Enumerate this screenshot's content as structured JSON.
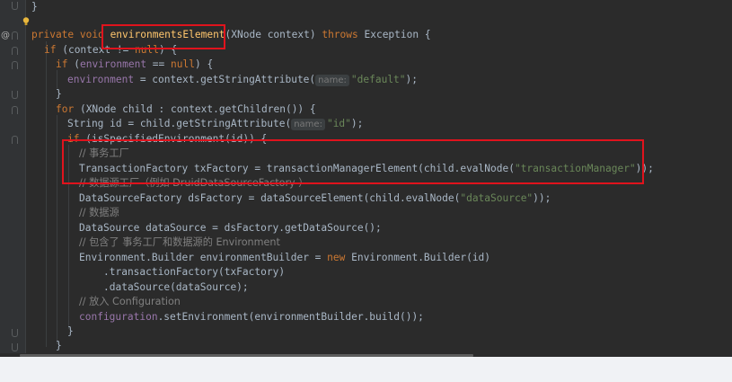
{
  "gutter": {
    "override_marker": "@"
  },
  "code": {
    "l0": "}",
    "l1_kw": "private void ",
    "l1_name": "environmentsElement",
    "l1_rest_a": "(XNode context) ",
    "l1_throws": "throws",
    "l1_rest_b": " Exception {",
    "l2_kw": "if",
    "l2_rest": " (context != ",
    "l2_null": "null",
    "l2_end": ") {",
    "l3_kw": "if",
    "l3_open": " (",
    "l3_field": "environment",
    "l3_mid": " == ",
    "l3_null": "null",
    "l3_end": ") {",
    "l4_field": "environment",
    "l4_rest": " = context.getStringAttribute(",
    "l4_hint": "name:",
    "l4_str": "\"default\"",
    "l4_end": ");",
    "l5": "}",
    "l6_kw": "for",
    "l6_rest": " (XNode child : context.getChildren()) {",
    "l7_rest": "String id = child.getStringAttribute(",
    "l7_hint": "name:",
    "l7_str": "\"id\"",
    "l7_end": ");",
    "l8_kw": "if",
    "l8_rest": " (isSpecifiedEnvironment(id)) {",
    "l9_cmt": "// 事务工厂",
    "l10_rest": "TransactionFactory txFactory = transactionManagerElement(child.evalNode(",
    "l10_str": "\"transactionManager\"",
    "l10_end": "));",
    "l11_cmt": "// 数据源工厂（例如 DruidDataSourceFactory ）",
    "l12_rest": "DataSourceFactory dsFactory = dataSourceElement(child.evalNode(",
    "l12_str": "\"dataSource\"",
    "l12_end": "));",
    "l13_cmt": "// 数据源",
    "l14_rest": "DataSource dataSource = dsFactory.getDataSource();",
    "l15_cmt": "// 包含了 事务工厂和数据源的 Environment",
    "l16_rest_a": "Environment.Builder environmentBuilder = ",
    "l16_new": "new",
    "l16_rest_b": " Environment.Builder(id)",
    "l17": ".transactionFactory(txFactory)",
    "l18": ".dataSource(dataSource);",
    "l19_cmt": "// 放入 Configuration",
    "l20_field": "configuration",
    "l20_rest": ".setEnvironment(environmentBuilder.build());",
    "l21": "}",
    "l22": "}"
  },
  "colors": {
    "background": "#2b2b2b",
    "keyword": "#cc7832",
    "field": "#9876aa",
    "string": "#6a8759",
    "comment": "#808080",
    "highlight_box": "#e0131d"
  }
}
